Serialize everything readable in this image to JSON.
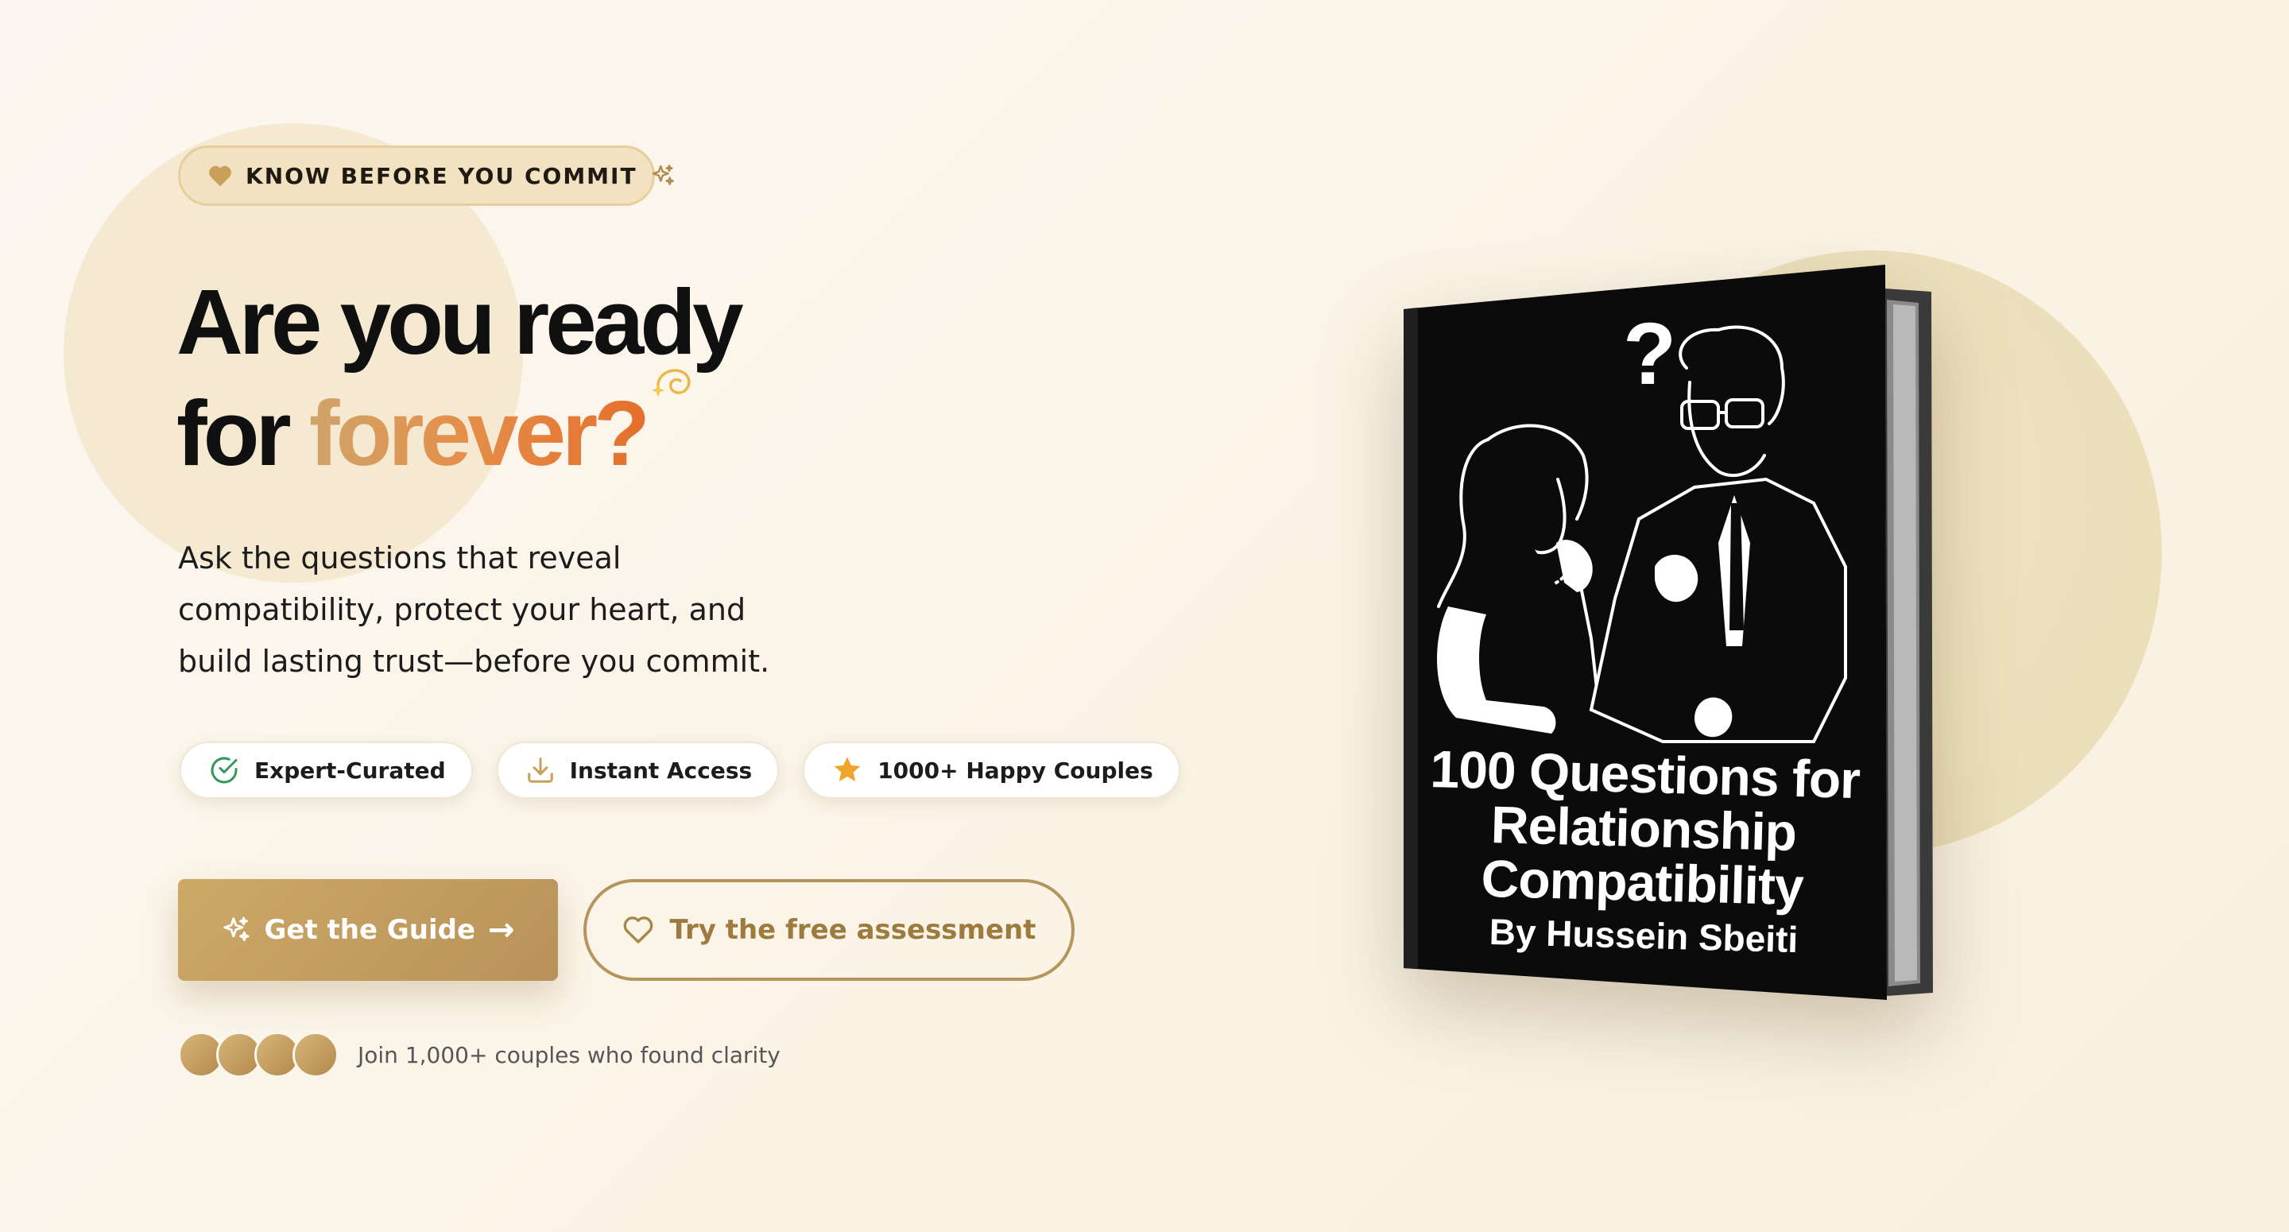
{
  "badge": {
    "text": "KNOW BEFORE YOU COMMIT",
    "icons": [
      "heart-icon",
      "sparkles-icon"
    ]
  },
  "hero": {
    "headline_line1": "Are you ready",
    "headline_line2_prefix": "for ",
    "headline_accent": "forever?",
    "subtitle": "Ask the questions that reveal compatibility, protect your heart, and build lasting trust—before you commit."
  },
  "features": [
    {
      "label": "Expert-Curated",
      "icon": "check-circle-icon"
    },
    {
      "label": "Instant Access",
      "icon": "download-icon"
    },
    {
      "label": "1000+ Happy Couples",
      "icon": "star-icon"
    }
  ],
  "cta": {
    "primary_label": "Get the Guide",
    "primary_arrow": "→",
    "secondary_label": "Try the free assessment"
  },
  "social_proof": {
    "avatar_count": 4,
    "text": "Join 1,000+ couples who found clarity"
  },
  "book": {
    "title": "100 Questions for Relationship Compatibility",
    "author": "By Hussein Sbeiti"
  },
  "colors": {
    "accent_gold": "#c4a062",
    "accent_orange": "#e4702d",
    "background": "#fbf5ea",
    "text_dark": "#111111"
  }
}
